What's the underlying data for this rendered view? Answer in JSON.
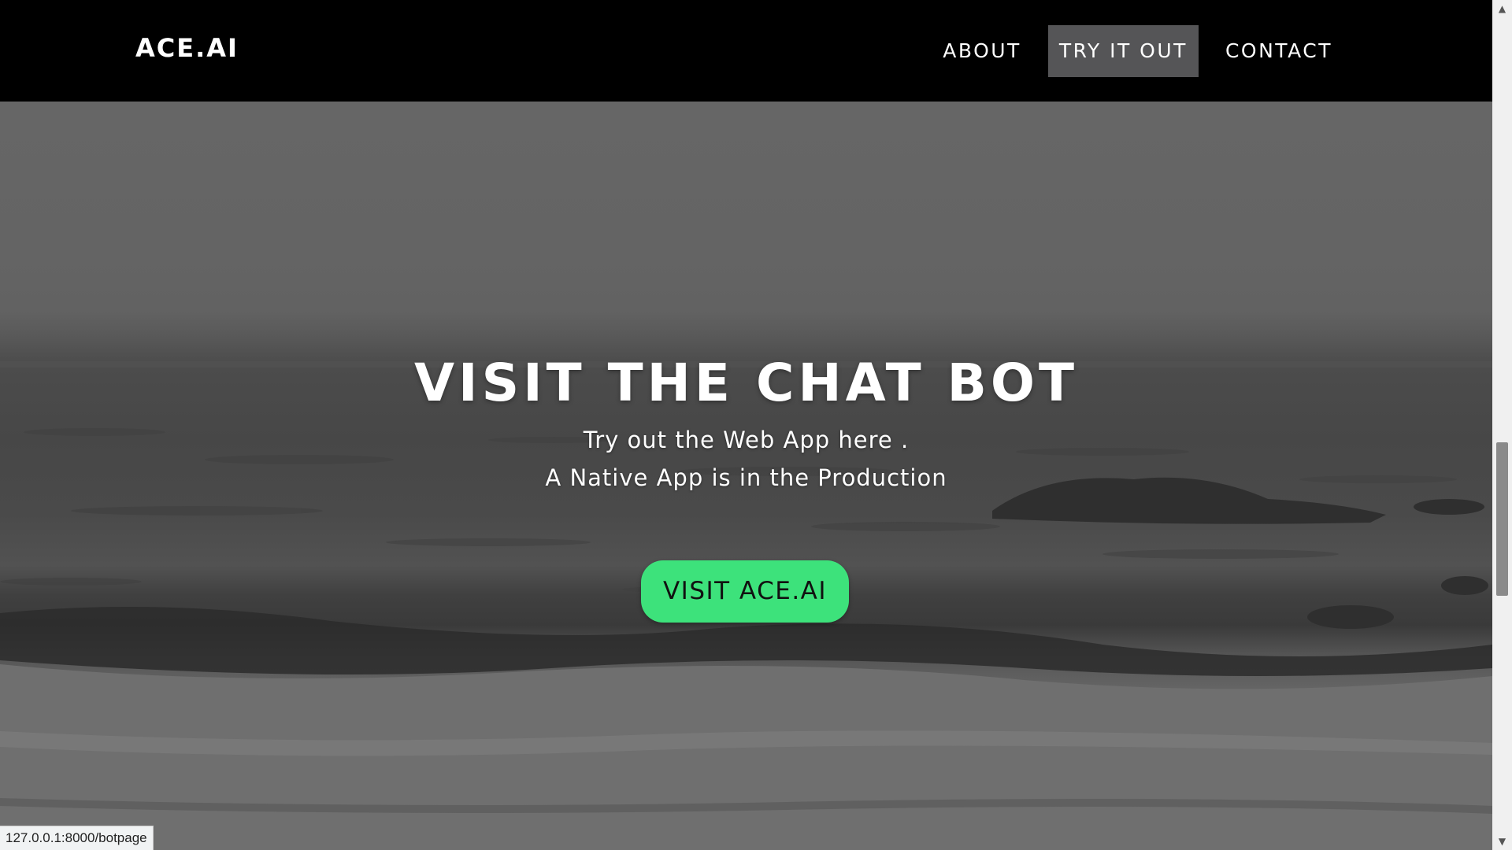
{
  "navbar": {
    "brand": "ACE.AI",
    "links": [
      {
        "label": "ABOUT"
      },
      {
        "label": "TRY IT OUT"
      },
      {
        "label": "CONTACT"
      }
    ]
  },
  "hero": {
    "title": "VISIT THE CHAT BOT",
    "subtitle_line1": "Try out the Web App here .",
    "subtitle_line2": "A Native App is in the Production",
    "cta_label": "VISIT ACE.AI"
  },
  "status_bar": {
    "url": "127.0.0.1:8000/botpage"
  },
  "colors": {
    "nav_bg": "#000000",
    "active_tab_bg": "#555557",
    "cta_bg": "#3de27b",
    "text": "#ffffff"
  },
  "icons": {
    "scroll_up": "chevron-up-icon",
    "scroll_down": "chevron-down-icon"
  }
}
